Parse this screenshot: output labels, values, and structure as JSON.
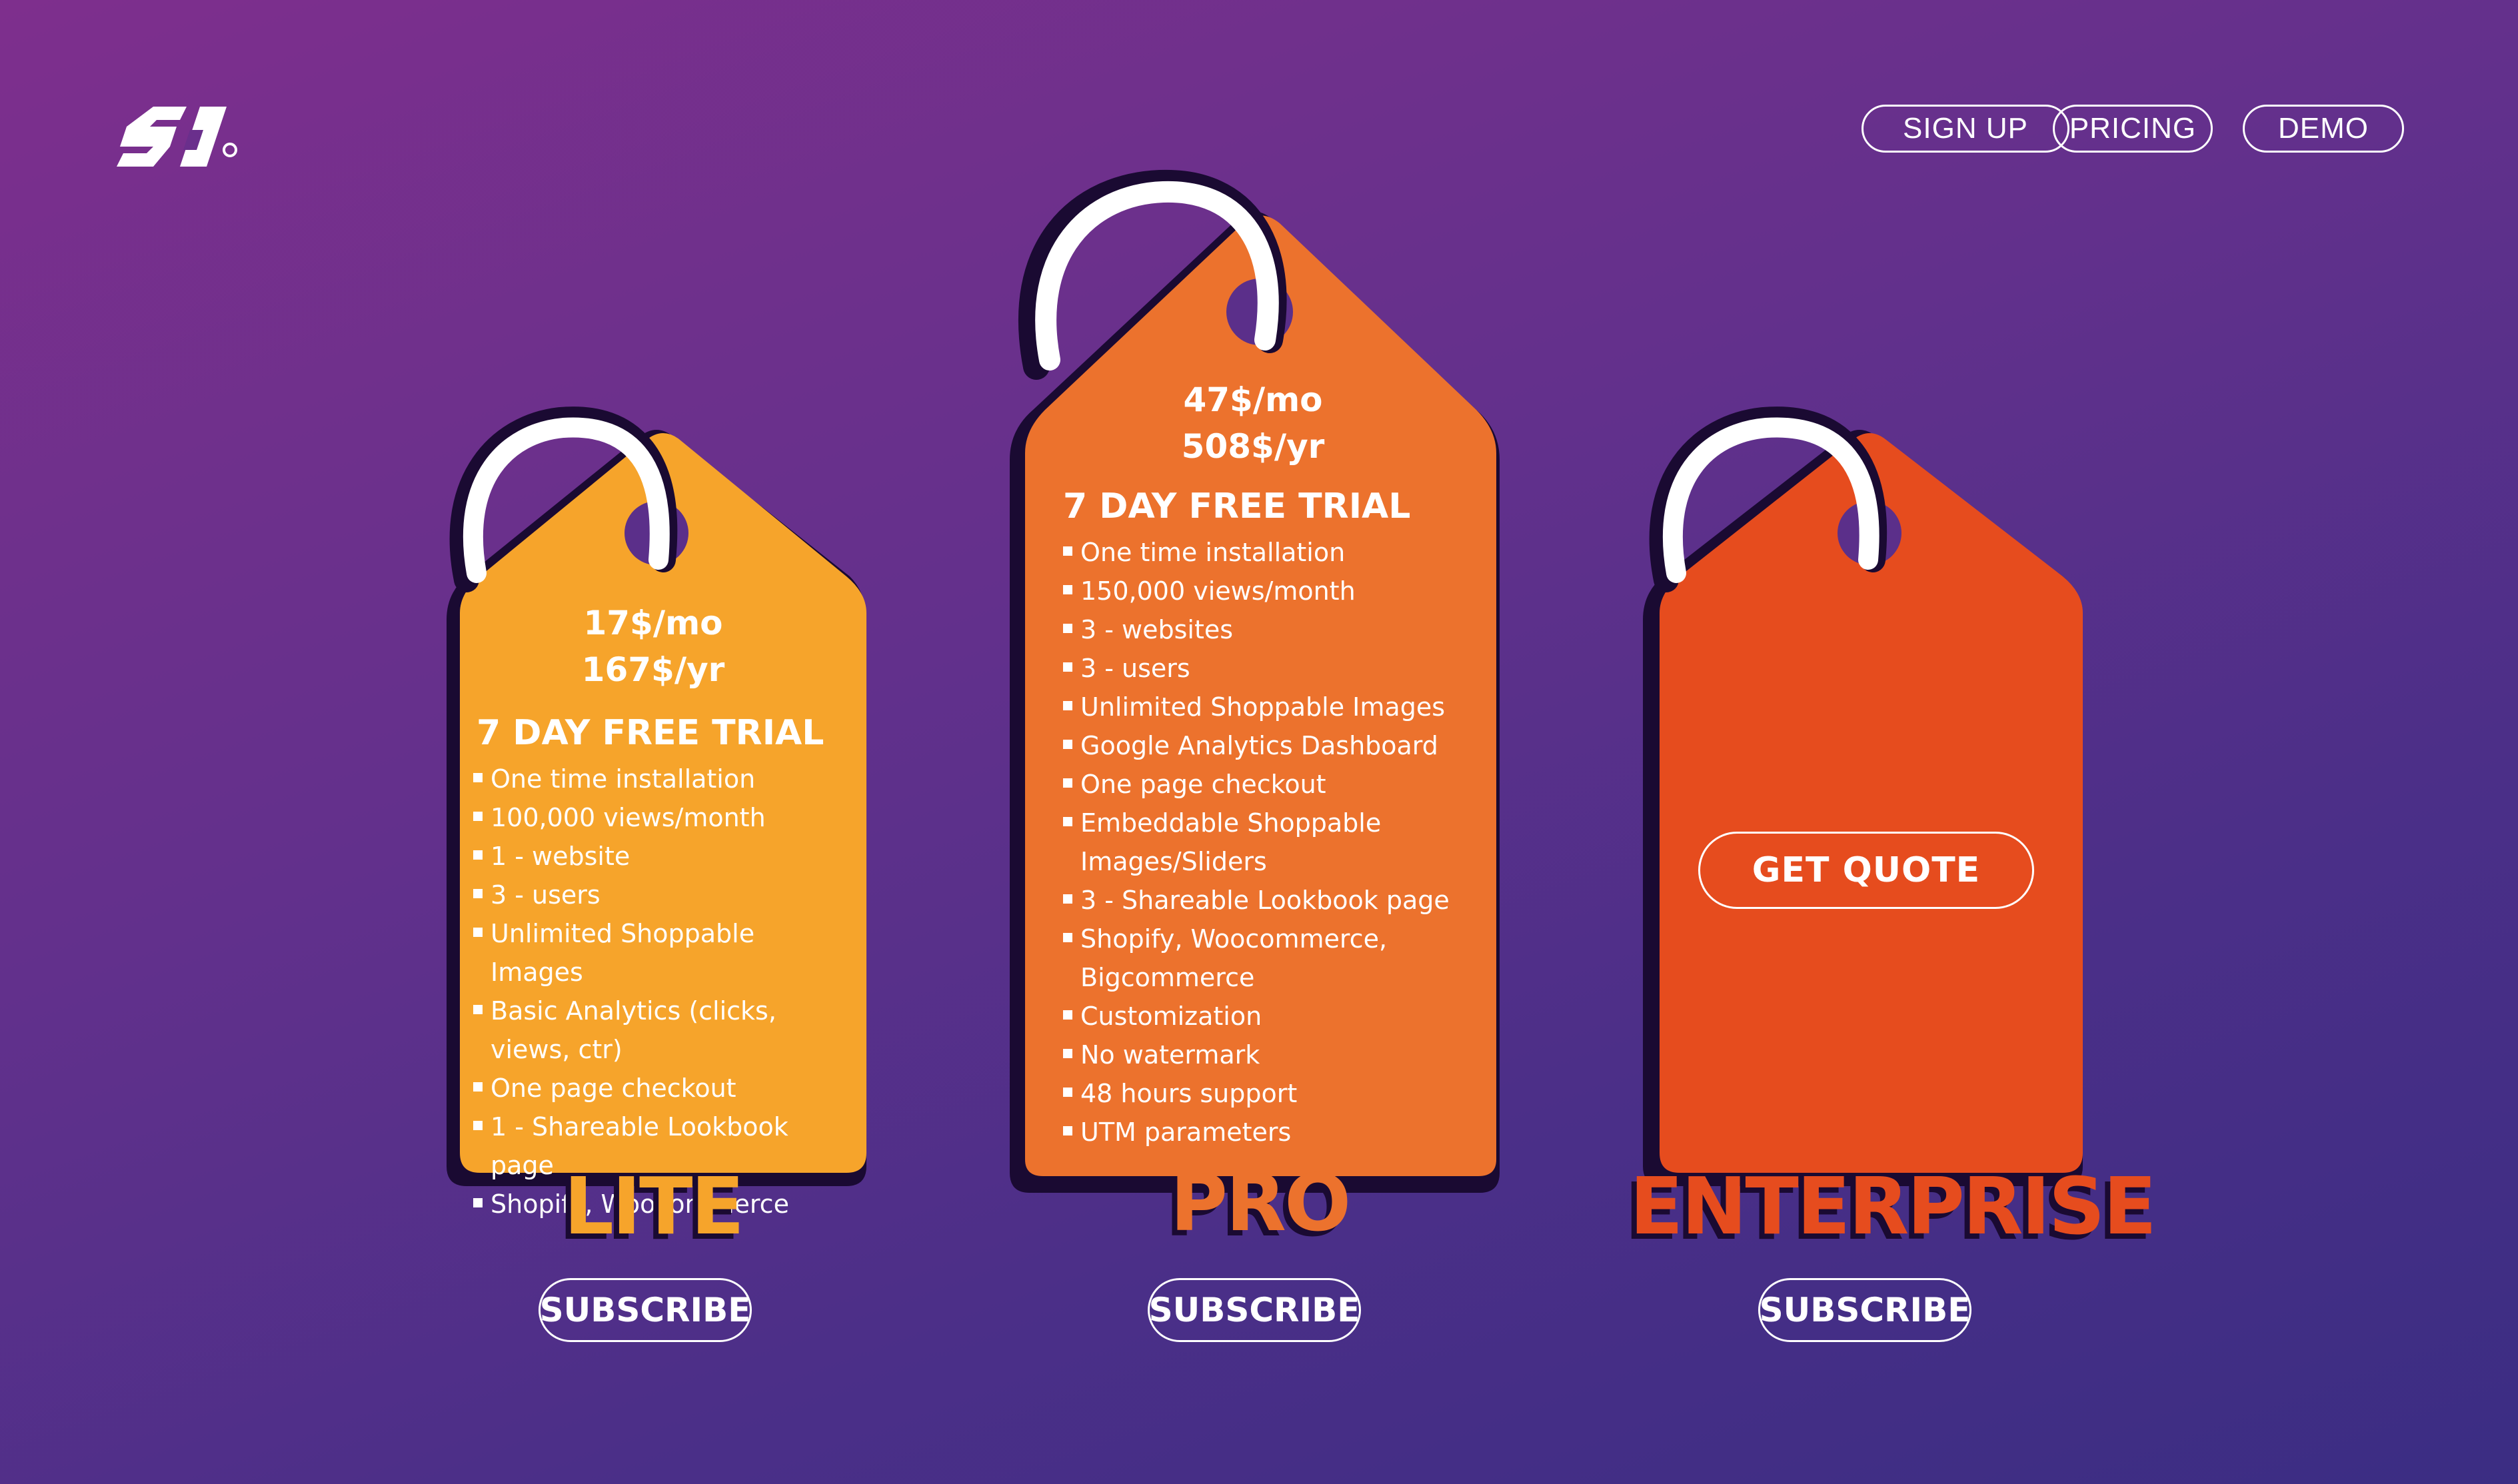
{
  "nav": {
    "sign_up": "SIGN UP",
    "pricing": "PRICING",
    "demo": "DEMO"
  },
  "colors": {
    "lite": "#f6a42b",
    "pro": "#ec722d",
    "enterprise": "#e64c1e",
    "shadow": "#1a0a32"
  },
  "plans": [
    {
      "name": "LITE",
      "price_month": "17$/mo",
      "price_year": "167$/yr",
      "trial": "7 DAY FREE TRIAL",
      "features": [
        "One time installation",
        "100,000 views/month",
        "1 - website",
        "3 - users",
        "Unlimited Shoppable Images",
        "Basic Analytics (clicks, views, ctr)",
        "One page checkout",
        "1 - Shareable Lookbook page",
        "Shopify, Woocommerce"
      ],
      "subscribe": "SUBSCRIBE"
    },
    {
      "name": "PRO",
      "price_month": "47$/mo",
      "price_year": "508$/yr",
      "trial": "7 DAY FREE TRIAL",
      "features": [
        "One time installation",
        "150,000 views/month",
        "3 - websites",
        "3 - users",
        "Unlimited Shoppable Images",
        "Google Analytics Dashboard",
        "One page checkout",
        "Embeddable Shoppable Images/Sliders",
        "3 - Shareable Lookbook page",
        "Shopify, Woocommerce, Bigcommerce",
        "Customization",
        "No watermark",
        "48 hours support",
        "UTM parameters"
      ],
      "subscribe": "SUBSCRIBE"
    },
    {
      "name": "ENTERPRISE",
      "cta": "GET QUOTE",
      "subscribe": "SUBSCRIBE"
    }
  ]
}
